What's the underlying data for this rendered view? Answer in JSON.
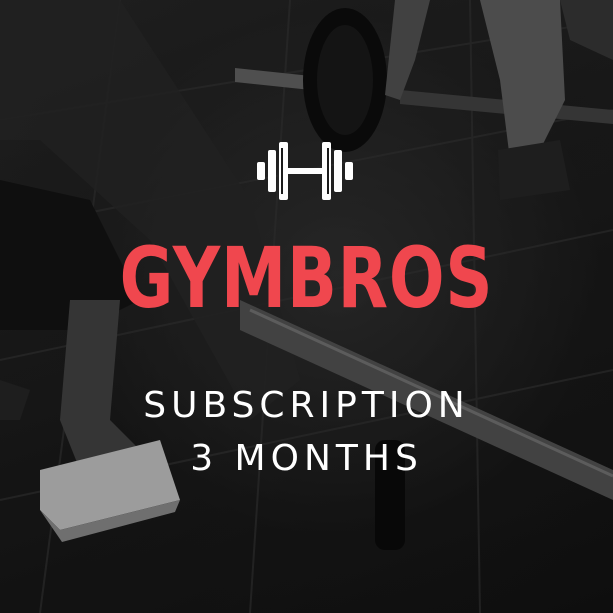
{
  "card": {
    "background_subject": "gym-barbell-deadlift-photo",
    "logo_icon": "dumbbell-icon",
    "brand_name": "GYMBROS",
    "subscription_label": "SUBSCRIPTION",
    "duration_label": "3 MONTHS"
  },
  "colors": {
    "brand_accent": "#f0474e",
    "subtitle_text": "#ffffff",
    "icon": "#ffffff",
    "background": "#1b1b1b"
  }
}
